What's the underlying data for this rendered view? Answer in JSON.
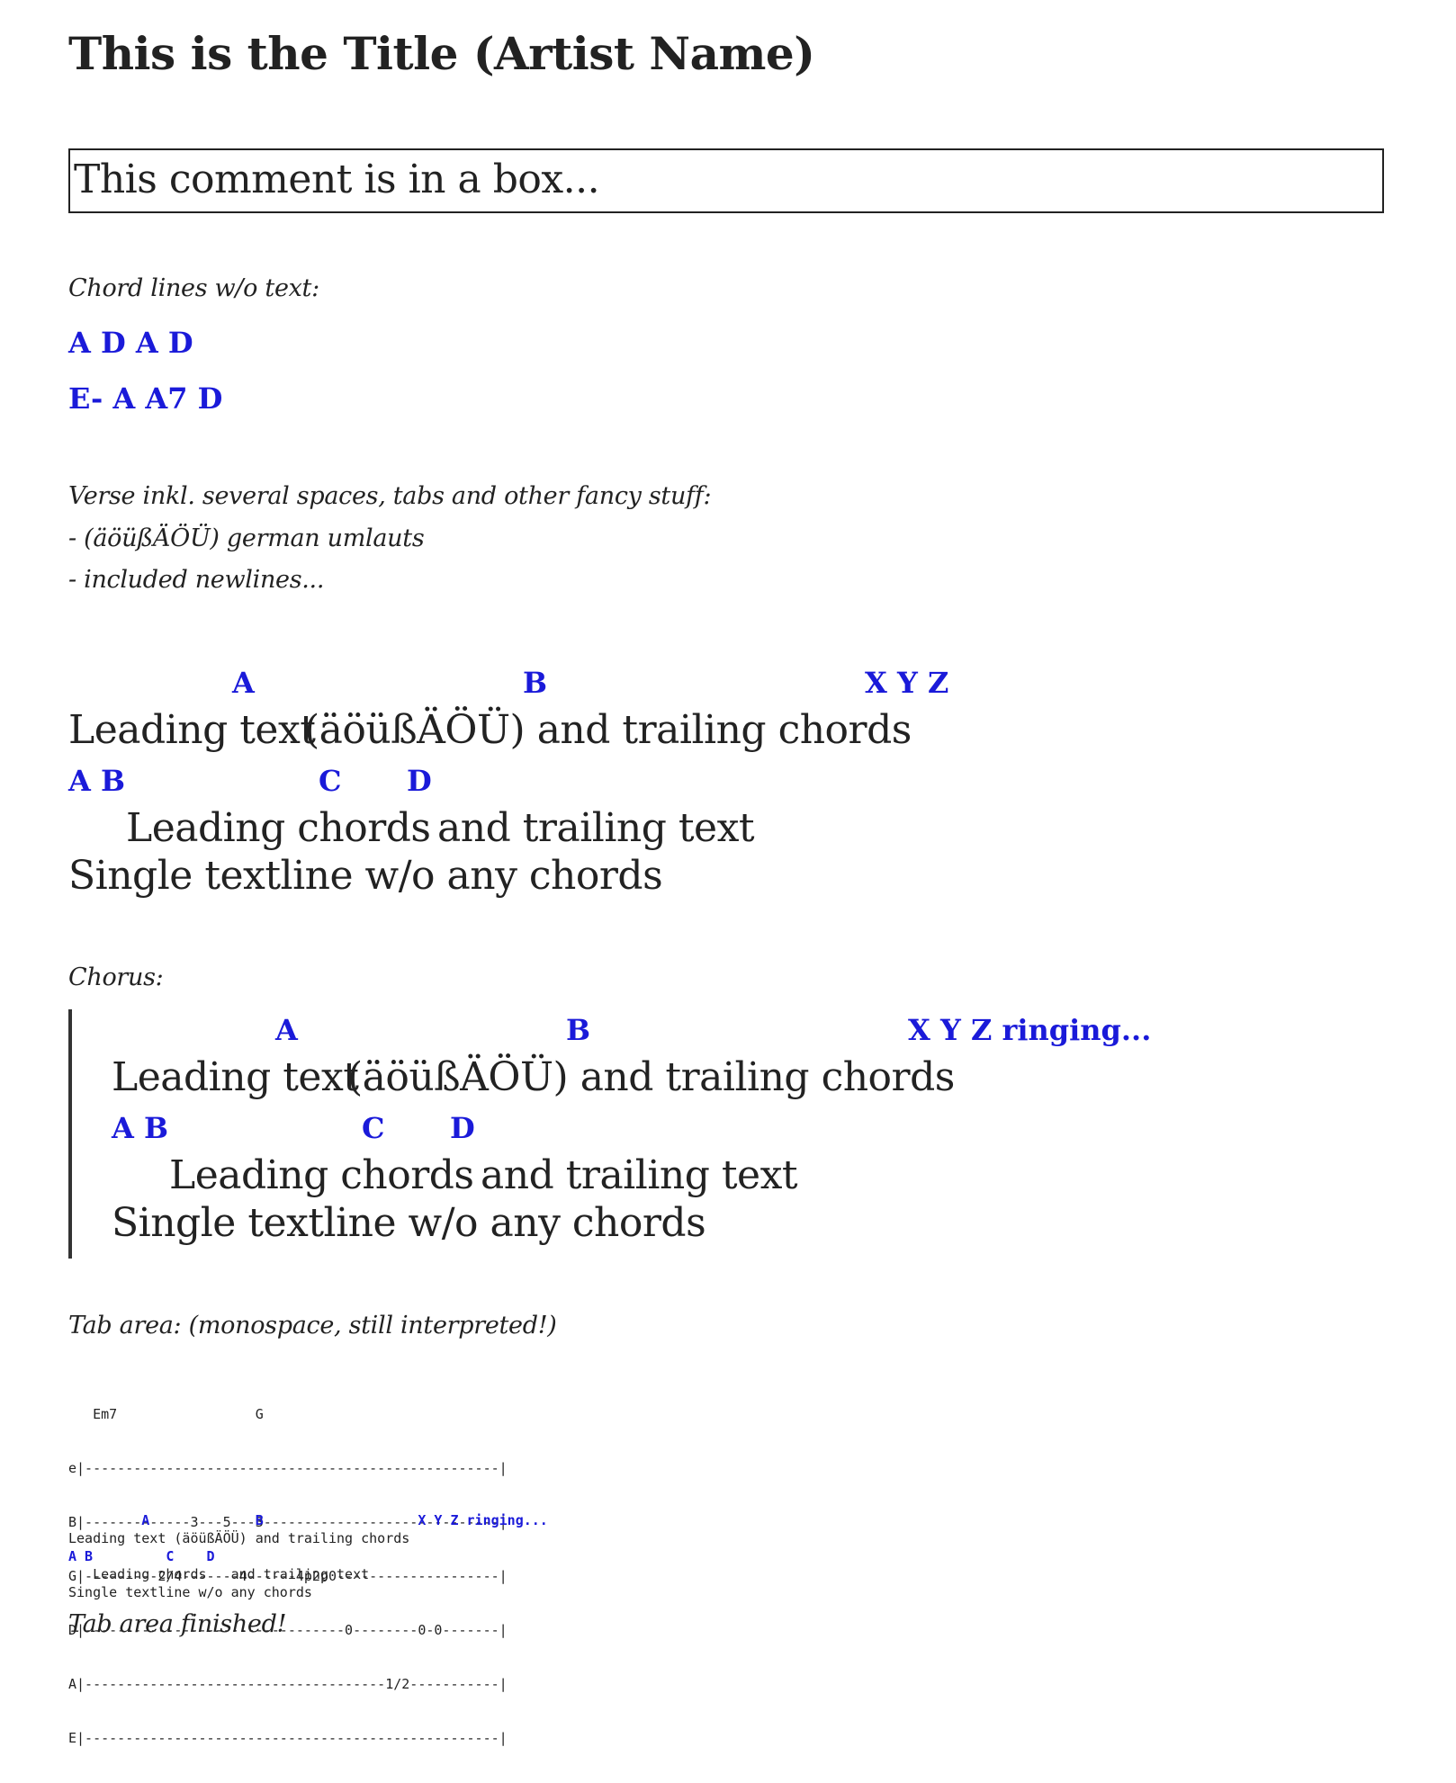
{
  "title": "This is the Title (Artist Name)",
  "box_comment": "This comment is in a box...",
  "chord_lines_label": "Chord lines w/o text:",
  "chord_lines": [
    "A D A D",
    "E- A A7 D"
  ],
  "verse_label": [
    "Verse inkl. several spaces, tabs and other fancy stuff:",
    "- (äöüßÄÖÜ) german umlauts",
    "- included newlines..."
  ],
  "verse": {
    "line1": {
      "chords": [
        "A",
        "B",
        "X Y Z"
      ],
      "texts": [
        "Leading text ",
        "(äöüßÄÖÜ) and trailing chords",
        ""
      ]
    },
    "line2": {
      "chords": [
        "A B",
        "C",
        "D"
      ],
      "texts": [
        "     Leading chords",
        "  ",
        " and trailing text"
      ]
    },
    "line3": "Single textline w/o any chords"
  },
  "chorus_label": "Chorus:",
  "chorus": {
    "line1": {
      "chords": [
        "A",
        "B",
        "X Y Z ringing..."
      ],
      "texts": [
        "Leading text ",
        "(äöüßÄÖÜ) and trailing chords",
        ""
      ]
    },
    "line2": {
      "chords": [
        "A B",
        "C",
        "D"
      ],
      "texts": [
        "     Leading chords",
        "  ",
        " and trailing text"
      ]
    },
    "line3": "Single textline w/o any chords"
  },
  "tab_label": "Tab area: (monospace, still interpreted!)",
  "tab_lines": [
    "   Em7                 G",
    "e|---------------------------------------------------|",
    "B|-------------3---5---3-----------------------------|",
    "G|---------2/4-------4------4p2p0--------------------|",
    "D|--------------------------------0--------0-0-------|",
    "A|-------------------------------------1/2-----------|",
    "E|---------------------------------------------------|"
  ],
  "tab_song": {
    "chords1": "         A             B                   X Y Z ringing...",
    "text1": "Leading text (äöüßÄÖÜ) and trailing chords",
    "chords2": "A B         C    D",
    "text2": "   Leading chords   and trailing text",
    "text3": "Single textline w/o any chords"
  },
  "tab_finished": "Tab area finished!"
}
